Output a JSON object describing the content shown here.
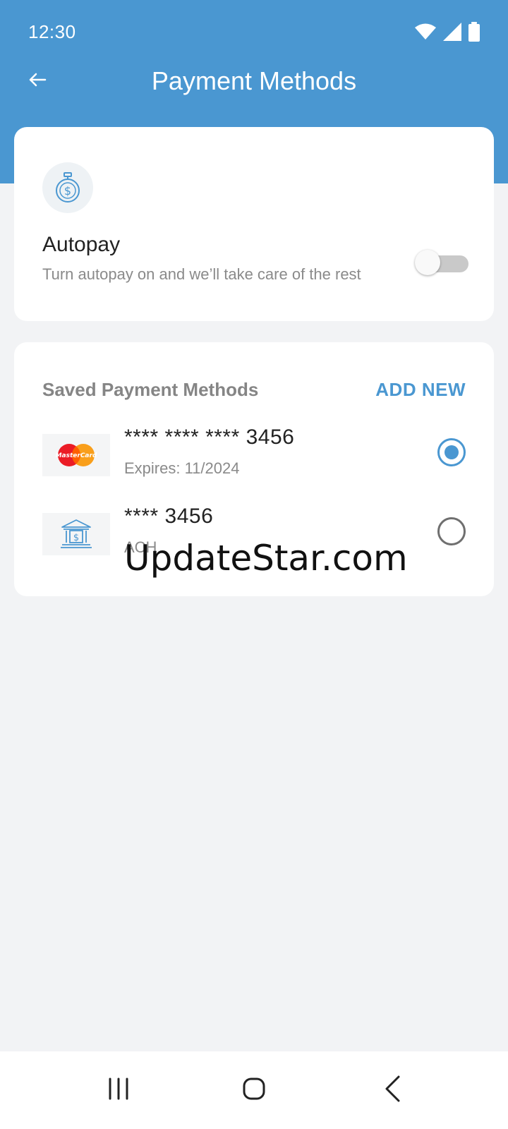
{
  "status_bar": {
    "time": "12:30"
  },
  "app_bar": {
    "title": "Payment Methods",
    "back_icon": "arrow-left-icon"
  },
  "autopay": {
    "icon": "stopwatch-dollar-icon",
    "title": "Autopay",
    "subtitle": "Turn autopay on and we’ll take care of the rest",
    "enabled": false
  },
  "saved_methods": {
    "header": "Saved Payment Methods",
    "add_new_label": "ADD NEW",
    "items": [
      {
        "logo": "mastercard-logo",
        "logo_text": "MasterCard",
        "number": "**** **** **** 3456",
        "detail": "Expires: 11/2024",
        "selected": true
      },
      {
        "logo": "bank-icon",
        "number": "**** 3456",
        "detail": "ACH",
        "selected": false
      }
    ]
  },
  "watermark": "UpdateStar.com",
  "colors": {
    "accent": "#4a97d1",
    "background": "#f2f3f5",
    "card": "#ffffff"
  },
  "nav_bar": {
    "recents_icon": "recents-icon",
    "home_icon": "home-icon",
    "back_icon": "nav-back-icon"
  }
}
